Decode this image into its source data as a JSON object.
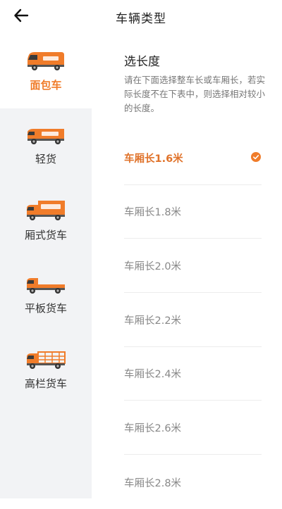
{
  "header": {
    "title": "车辆类型"
  },
  "colors": {
    "accent": "#f07c2a",
    "sidebar_bg": "#f2f3f5"
  },
  "sidebar": {
    "items": [
      {
        "label": "面包车",
        "icon": "van-icon",
        "active": true
      },
      {
        "label": "轻货",
        "icon": "small-truck-icon",
        "active": false
      },
      {
        "label": "厢式货车",
        "icon": "box-truck-icon",
        "active": false
      },
      {
        "label": "平板货车",
        "icon": "flatbed-truck-icon",
        "active": false
      },
      {
        "label": "高栏货车",
        "icon": "high-rail-truck-icon",
        "active": false
      }
    ]
  },
  "main": {
    "section_title": "选长度",
    "description": "请在下面选择整车长或车厢长，若实际长度不在下表中，则选择相对较小的长度。",
    "options": [
      {
        "label": "车厢长1.6米",
        "selected": true
      },
      {
        "label": "车厢长1.8米",
        "selected": false
      },
      {
        "label": "车厢长2.0米",
        "selected": false
      },
      {
        "label": "车厢长2.2米",
        "selected": false
      },
      {
        "label": "车厢长2.4米",
        "selected": false
      },
      {
        "label": "车厢长2.6米",
        "selected": false
      },
      {
        "label": "车厢长2.8米",
        "selected": false
      }
    ]
  }
}
